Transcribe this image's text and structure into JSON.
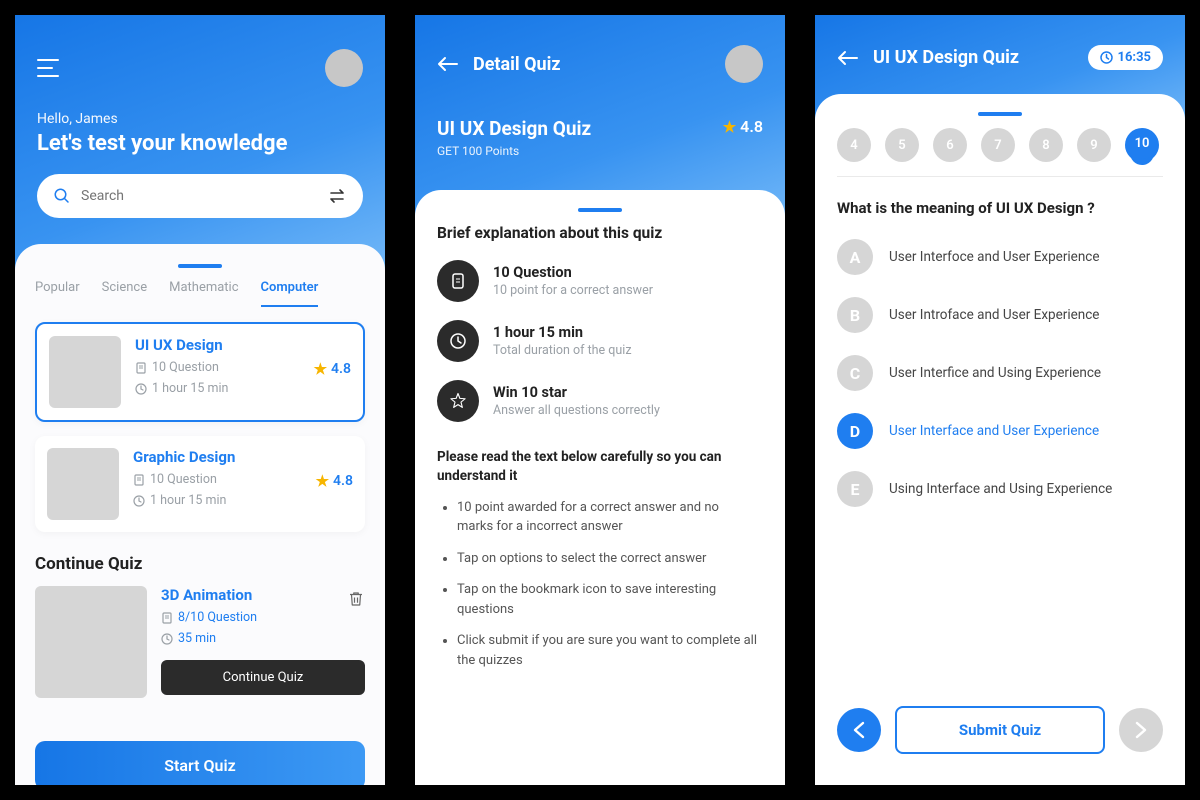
{
  "screen1": {
    "hello": "Hello, James",
    "title": "Let's test your knowledge",
    "search_placeholder": "Search",
    "tabs": [
      "Popular",
      "Science",
      "Mathematic",
      "Computer"
    ],
    "active_tab": 3,
    "quizzes": [
      {
        "title": "UI UX Design",
        "questions": "10 Question",
        "duration": "1 hour 15 min",
        "rating": "4.8",
        "selected": true
      },
      {
        "title": "Graphic Design",
        "questions": "10 Question",
        "duration": "1 hour 15 min",
        "rating": "4.8",
        "selected": false
      }
    ],
    "continue_heading": "Continue Quiz",
    "continue": {
      "title": "3D Animation",
      "progress": "8/10 Question",
      "time": "35 min",
      "button": "Continue Quiz"
    },
    "start_button": "Start Quiz"
  },
  "screen2": {
    "page_title": "Detail Quiz",
    "quiz_name": "UI UX Design Quiz",
    "quiz_sub": "GET 100 Points",
    "rating": "4.8",
    "brief_title": "Brief explanation about this quiz",
    "info": [
      {
        "title": "10 Question",
        "sub": "10 point for a correct answer"
      },
      {
        "title": "1 hour 15 min",
        "sub": "Total duration of the quiz"
      },
      {
        "title": "Win 10 star",
        "sub": "Answer all questions correctly"
      }
    ],
    "read_title": "Please read the text below carefully so you can understand it",
    "bullets": [
      "10 point awarded for a correct answer and no marks for a incorrect answer",
      "Tap on options to select the correct answer",
      "Tap on the bookmark icon to save interesting questions",
      "Click submit if you are sure you want to complete all the quizzes"
    ]
  },
  "screen3": {
    "page_title": "UI UX Design Quiz",
    "timer": "16:35",
    "numbers": [
      "4",
      "5",
      "6",
      "7",
      "8",
      "9",
      "10"
    ],
    "active_number": 6,
    "question": "What is the meaning of UI UX Design ?",
    "options": [
      {
        "label": "A",
        "text": "User Interfoce and User Experience"
      },
      {
        "label": "B",
        "text": "User Introface and User Experience"
      },
      {
        "label": "C",
        "text": "User Interfice and Using Experience"
      },
      {
        "label": "D",
        "text": "User Interface and User Experience"
      },
      {
        "label": "E",
        "text": "Using Interface and Using Experience"
      }
    ],
    "selected_option": 3,
    "submit": "Submit Quiz"
  }
}
